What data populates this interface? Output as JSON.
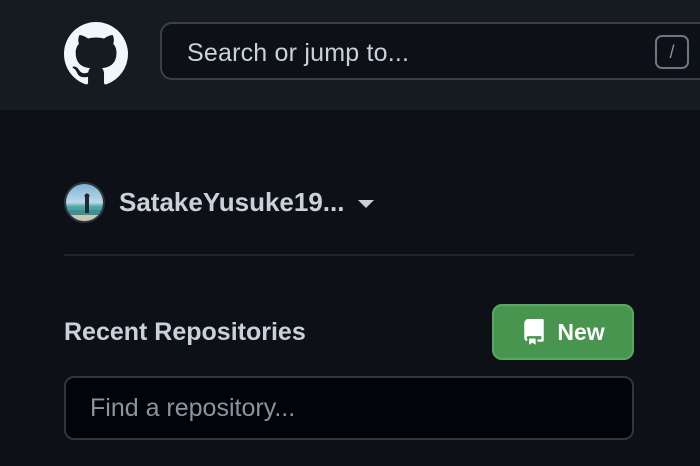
{
  "header": {
    "logo_icon": "github-octocat-icon",
    "search": {
      "placeholder": "Search or jump to...",
      "shortcut_key": "/"
    }
  },
  "sidebar": {
    "account": {
      "username": "SatakeYusuke19...",
      "avatar_icon": "user-avatar",
      "dropdown_icon": "caret-down-icon"
    },
    "recent_repositories": {
      "title": "Recent Repositories",
      "new_button": {
        "icon": "repo-icon",
        "label": "New",
        "color": "#47954e"
      },
      "filter": {
        "placeholder": "Find a repository..."
      }
    }
  },
  "colors": {
    "header_bg": "#161b22",
    "page_bg": "#0d1117",
    "text": "#c9d1d9",
    "muted": "#8b949e",
    "border": "#30363d"
  }
}
